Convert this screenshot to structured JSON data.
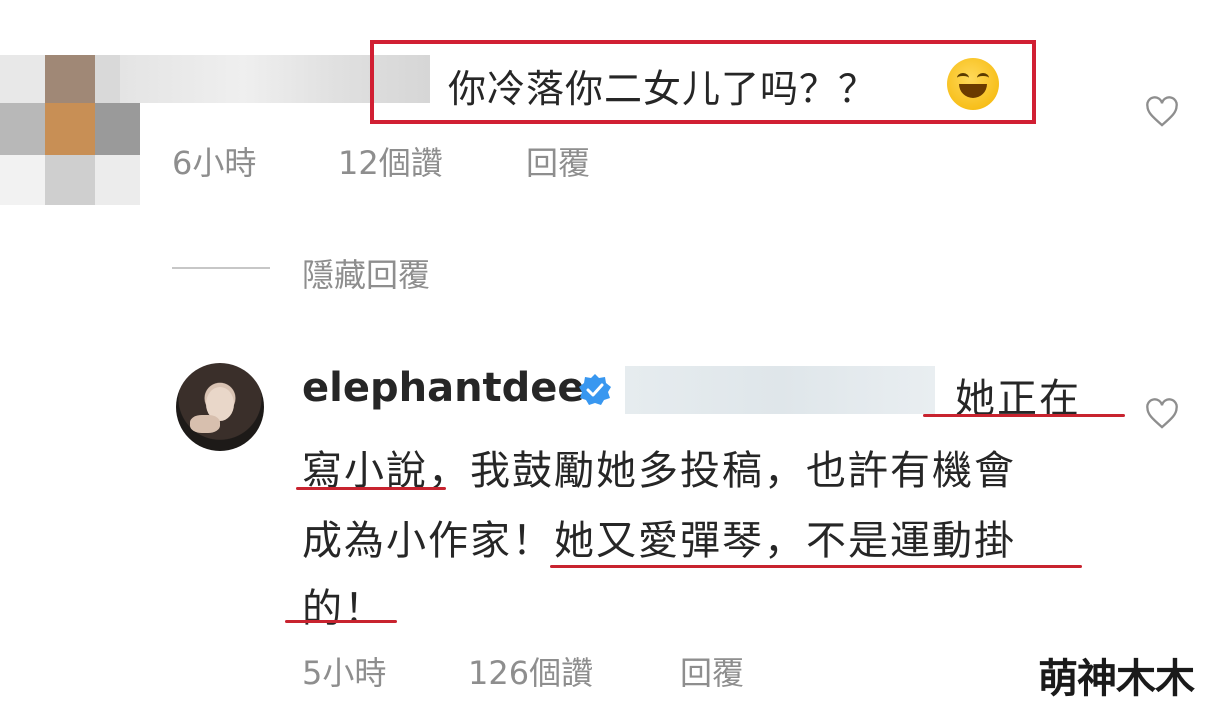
{
  "comment": {
    "text": "你冷落你二女儿了吗？？",
    "emoji_icon": "grinning-squinting-face-icon",
    "time": "6小時",
    "likes": "12個讚",
    "reply_label": "回覆"
  },
  "thread": {
    "hide_replies_label": "隱藏回覆"
  },
  "reply": {
    "username": "elephantdee",
    "verified_icon": "verified-badge-icon",
    "lines": [
      "她正在",
      "寫小說，我鼓勵她多投稿，也許有機會",
      "成為小作家！她又愛彈琴，不是運動掛",
      "的！"
    ],
    "time": "5小時",
    "likes": "126個讚",
    "reply_label": "回覆"
  },
  "colors": {
    "highlight_red": "#d11f33",
    "meta_gray": "#8e8e8e",
    "verified_blue": "#3897f0"
  },
  "watermark": "萌神木木"
}
